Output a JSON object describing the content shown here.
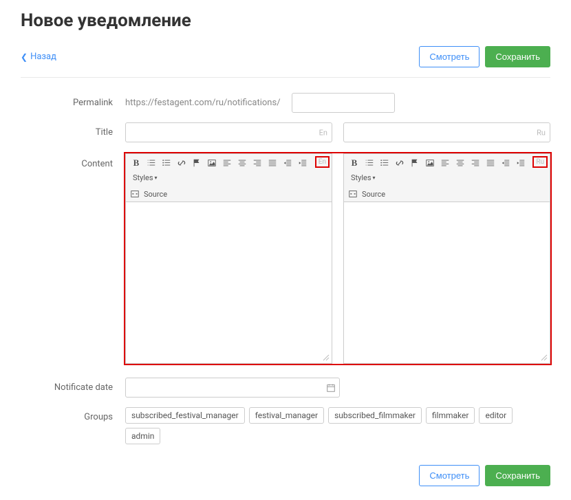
{
  "page_title": "Новое уведомление",
  "nav": {
    "back": "Назад"
  },
  "actions": {
    "view": "Смотреть",
    "save": "Сохранить"
  },
  "labels": {
    "permalink": "Permalink",
    "title": "Title",
    "content": "Content",
    "notificate_date": "Notificate date",
    "groups": "Groups"
  },
  "permalink": {
    "prefix": "https://festagent.com/ru/notifications/",
    "value": ""
  },
  "title": {
    "en": "",
    "ru": ""
  },
  "lang": {
    "en": "En",
    "ru": "Ru"
  },
  "toolbar": {
    "styles": "Styles",
    "source": "Source"
  },
  "notificate_date": "",
  "groups": [
    "subscribed_festival_manager",
    "festival_manager",
    "subscribed_filmmaker",
    "filmmaker",
    "editor",
    "admin"
  ]
}
